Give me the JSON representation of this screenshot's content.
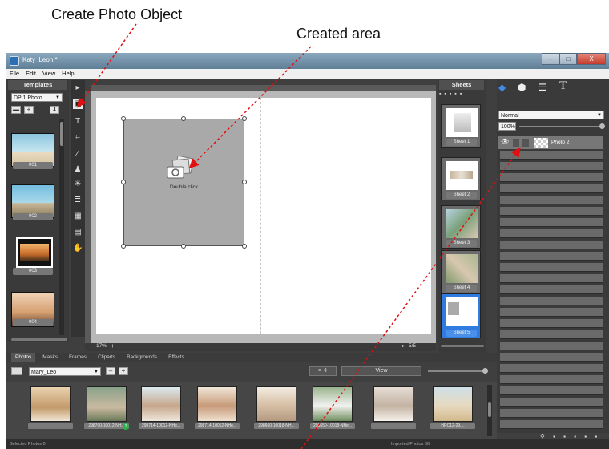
{
  "callouts": {
    "create_photo": "Create Photo Object",
    "created_area": "Created area"
  },
  "window": {
    "title": "Katy_Leon *",
    "minimize": "–",
    "maximize": "□",
    "close": "X"
  },
  "menu": [
    "File",
    "Edit",
    "View",
    "Help"
  ],
  "templates": {
    "header": "Templates",
    "dropdown_value": "DP 1 Photo",
    "items": [
      {
        "label": "001"
      },
      {
        "label": "002"
      },
      {
        "label": "003"
      },
      {
        "label": "004"
      }
    ]
  },
  "canvas": {
    "frame_hint": "Double click",
    "zoom": "17%",
    "zoom_plus": "+",
    "page_counter": "5/5"
  },
  "sheets": {
    "header": "Sheets",
    "items": [
      {
        "label": "Sheet 1"
      },
      {
        "label": "Sheet 2"
      },
      {
        "label": "Sheet 3"
      },
      {
        "label": "Sheet 4"
      },
      {
        "label": "Sheet 5"
      }
    ]
  },
  "layers": {
    "blend_mode": "Normal",
    "opacity": "100%",
    "layer_name": "Photo 2",
    "panel_icons": [
      "layers-icon",
      "cube-icon",
      "sliders-icon",
      "text-icon"
    ]
  },
  "bottom_tabs": [
    "Photos",
    "Masks",
    "Frames",
    "Cliparts",
    "Backgrounds",
    "Effects"
  ],
  "photos": {
    "album_value": "Mary_Leo",
    "minus": "–",
    "plus": "+",
    "view_label": "View",
    "badge": "1",
    "captions": [
      "",
      "298700-10012-NH...",
      "298714-10012-NHe...",
      "298714-10012-NHe...",
      "298660-10018-NH...",
      "298650-10018-NHe...",
      "",
      "HRC12-29...."
    ]
  },
  "status": {
    "left": "Selected Photos 0",
    "right": "Imported Photos 36"
  },
  "colors": {
    "accent": "#2f7be0",
    "arrow": "#e01010"
  }
}
